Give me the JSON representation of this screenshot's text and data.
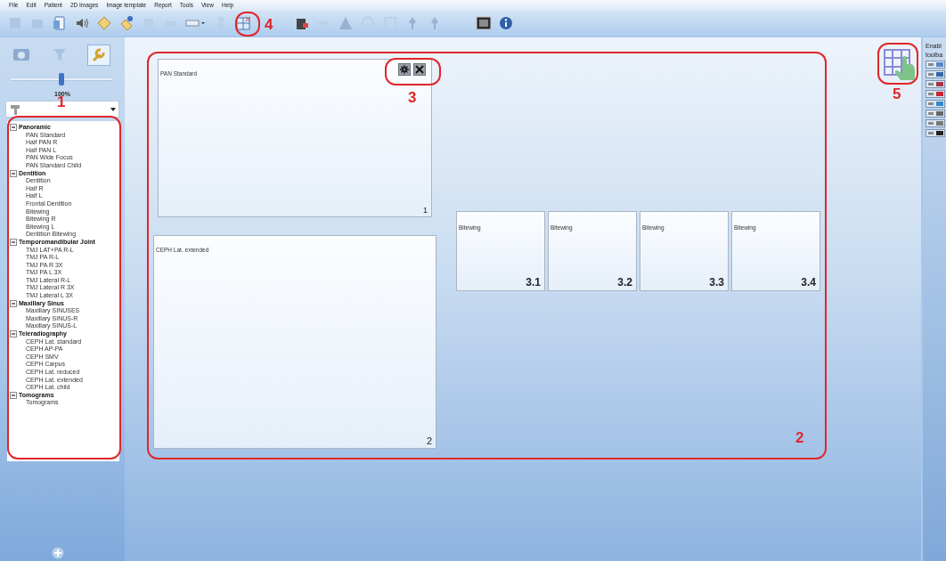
{
  "menu_bar": {
    "items": [
      "File",
      "Edit",
      "Patient",
      "2D Images",
      "Image template",
      "Report",
      "Tools",
      "View",
      "Help"
    ]
  },
  "left_panel": {
    "zoom_slider": {
      "level": 0.5
    },
    "zoom_reading": "100%",
    "tree": [
      {
        "label": "Panoramic",
        "expanded": true,
        "children": [
          {
            "label": "PAN Standard"
          },
          {
            "label": "Half PAN R"
          },
          {
            "label": "Half PAN L"
          },
          {
            "label": "PAN Wide Focus"
          },
          {
            "label": "PAN Standard Child"
          }
        ]
      },
      {
        "label": "Dentition",
        "expanded": true,
        "children": [
          {
            "label": "Dentition"
          },
          {
            "label": "Half R"
          },
          {
            "label": "Half L"
          },
          {
            "label": "Frontal Dentition"
          },
          {
            "label": "Bitewing"
          },
          {
            "label": "Bitewing R"
          },
          {
            "label": "Bitewing L"
          },
          {
            "label": "Dentition Bitewing"
          }
        ]
      },
      {
        "label": "Temporomandibular Joint",
        "expanded": true,
        "children": [
          {
            "label": "TMJ LAT+PA R-L"
          },
          {
            "label": "TMJ PA R-L"
          },
          {
            "label": "TMJ PA R 3X"
          },
          {
            "label": "TMJ PA L 3X"
          },
          {
            "label": "TMJ Lateral R-L"
          },
          {
            "label": "TMJ Lateral R 3X"
          },
          {
            "label": "TMJ Lateral L 3X"
          }
        ]
      },
      {
        "label": "Maxillary Sinus",
        "expanded": true,
        "children": [
          {
            "label": "Maxillary SINUSES"
          },
          {
            "label": "Maxillary SINUS-R"
          },
          {
            "label": "Maxillary SINUS-L"
          }
        ]
      },
      {
        "label": "Teleradiography",
        "expanded": true,
        "children": [
          {
            "label": "CEPH Lat. standard"
          },
          {
            "label": "CEPH AP-PA"
          },
          {
            "label": "CEPH SMV"
          },
          {
            "label": "CEPH Carpus"
          },
          {
            "label": "CEPH Lat. reduced"
          },
          {
            "label": "CEPH Lat. extended"
          },
          {
            "label": "CEPH Lat. child"
          }
        ]
      },
      {
        "label": "Tomograms",
        "expanded": true,
        "children": [
          {
            "label": "Tomograms"
          }
        ]
      }
    ]
  },
  "workspace": {
    "slots": [
      {
        "kind": "pan",
        "label": "PAN Standard",
        "number": "1",
        "controls_shown": true
      },
      {
        "kind": "ceph",
        "label": "CEPH Lat. extended",
        "number": "2",
        "controls_shown": false
      },
      {
        "kind": "bitewing",
        "label": "Bitewing",
        "number": "3.1",
        "controls_shown": false
      },
      {
        "kind": "bitewing",
        "label": "Bitewing",
        "number": "3.2",
        "controls_shown": false
      },
      {
        "kind": "bitewing",
        "label": "Bitewing",
        "number": "3.3",
        "controls_shown": false
      },
      {
        "kind": "bitewing",
        "label": "Bitewing",
        "number": "3.4",
        "controls_shown": false
      }
    ]
  },
  "right_panel": {
    "title_lines": [
      "Enabl",
      "toolba"
    ]
  },
  "annotations": [
    {
      "label": "1"
    },
    {
      "label": "2"
    },
    {
      "label": "3"
    },
    {
      "label": "4"
    },
    {
      "label": "5"
    }
  ]
}
